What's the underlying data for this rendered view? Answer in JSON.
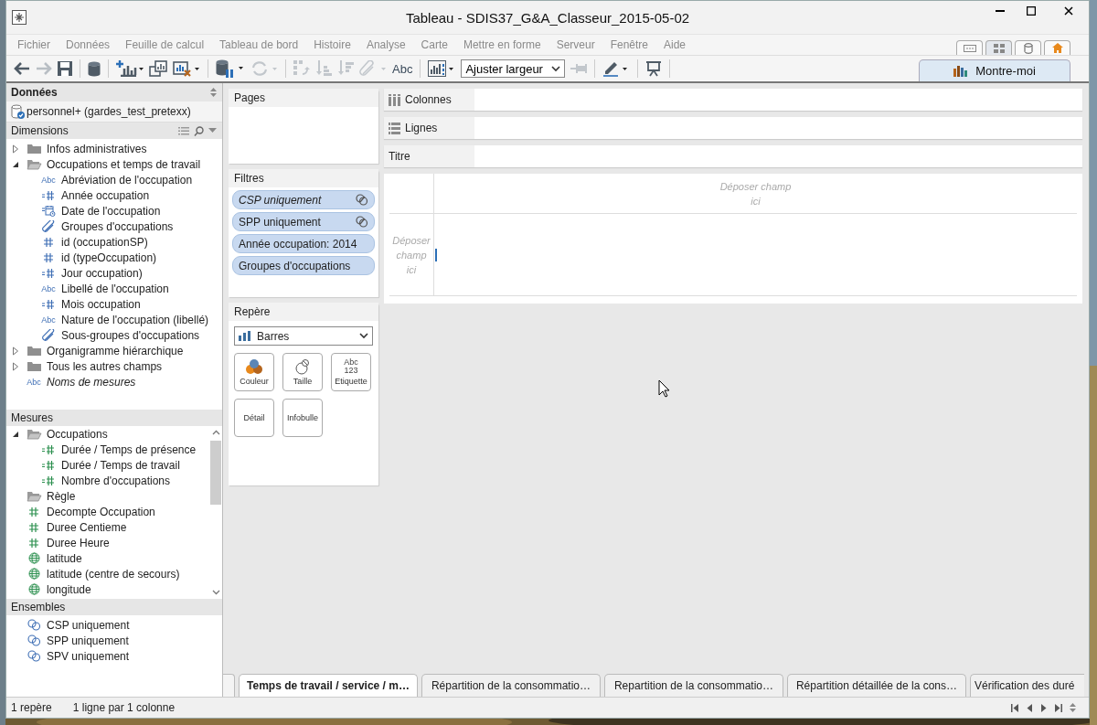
{
  "window": {
    "title": "Tableau - SDIS37_G&A_Classeur_2015-05-02"
  },
  "menu": [
    "Fichier",
    "Données",
    "Feuille de calcul",
    "Tableau de bord",
    "Histoire",
    "Analyse",
    "Carte",
    "Mettre en forme",
    "Serveur",
    "Fenêtre",
    "Aide"
  ],
  "toolbar": {
    "label_button": "Abc",
    "fit": "Ajuster largeur",
    "show_me": "Montre-moi"
  },
  "data_pane": {
    "title": "Données",
    "source": "personnel+ (gardes_test_pretexx)",
    "dimensions": {
      "title": "Dimensions",
      "items": [
        {
          "label": "Infos administratives",
          "kind": "folder",
          "expanded": false
        },
        {
          "label": "Occupations et temps de travail",
          "kind": "folder",
          "expanded": true,
          "children": [
            {
              "label": "Abréviation de l'occupation",
              "kind": "abc",
              "type_label": "Abc"
            },
            {
              "label": "Année occupation",
              "kind": "discrete-number"
            },
            {
              "label": "Date de l'occupation",
              "kind": "date"
            },
            {
              "label": "Groupes d'occupations",
              "kind": "group"
            },
            {
              "label": "id (occupationSP)",
              "kind": "number"
            },
            {
              "label": "id (typeOccupation)",
              "kind": "number"
            },
            {
              "label": "Jour occupation)",
              "kind": "discrete-number"
            },
            {
              "label": "Libellé de l'occupation",
              "kind": "abc",
              "type_label": "Abc"
            },
            {
              "label": "Mois occupation",
              "kind": "discrete-number"
            },
            {
              "label": "Nature de l'occupation (libellé)",
              "kind": "abc",
              "type_label": "Abc"
            },
            {
              "label": "Sous-groupes d'occupations",
              "kind": "group"
            }
          ]
        },
        {
          "label": "Organigramme hiérarchique",
          "kind": "folder",
          "expanded": false
        },
        {
          "label": "Tous les autres champs",
          "kind": "folder",
          "expanded": false
        },
        {
          "label": "Noms de mesures",
          "kind": "measure-names",
          "type_label": "Abc"
        }
      ]
    },
    "measures": {
      "title": "Mesures",
      "items": [
        {
          "label": "Occupations",
          "kind": "folder",
          "expanded": true,
          "children": [
            {
              "label": "Durée / Temps de présence",
              "kind": "discrete-number"
            },
            {
              "label": "Durée / Temps de travail",
              "kind": "discrete-number"
            },
            {
              "label": "Nombre d'occupations",
              "kind": "discrete-number"
            }
          ]
        },
        {
          "label": "Règle",
          "kind": "folder",
          "expanded": true
        },
        {
          "label": "Decompte Occupation",
          "kind": "number"
        },
        {
          "label": "Duree Centieme",
          "kind": "number"
        },
        {
          "label": "Duree Heure",
          "kind": "number"
        },
        {
          "label": "latitude",
          "kind": "globe"
        },
        {
          "label": "latitude (centre de secours)",
          "kind": "globe"
        },
        {
          "label": "longitude",
          "kind": "globe"
        }
      ]
    },
    "sets": {
      "title": "Ensembles",
      "items": [
        {
          "label": "CSP uniquement",
          "kind": "set"
        },
        {
          "label": "SPP uniquement",
          "kind": "set"
        },
        {
          "label": "SPV uniquement",
          "kind": "set"
        }
      ]
    }
  },
  "pages": {
    "title": "Pages"
  },
  "filters": {
    "title": "Filtres",
    "pills": [
      {
        "label": "CSP uniquement",
        "kind": "set",
        "italic": true
      },
      {
        "label": "SPP uniquement",
        "kind": "set",
        "italic": false
      },
      {
        "label": "Année occupation: 2014",
        "kind": "field",
        "italic": false
      },
      {
        "label": "Groupes d'occupations",
        "kind": "field",
        "italic": false
      }
    ]
  },
  "marks": {
    "title": "Repère",
    "mark_type": "Barres",
    "cards": [
      {
        "kind": "color",
        "label": "Couleur"
      },
      {
        "kind": "size",
        "label": "Taille"
      },
      {
        "kind": "text",
        "label": "Etiquette",
        "icon_lines": [
          "Abc",
          "123"
        ]
      },
      {
        "kind": "detail",
        "label": "Détail"
      },
      {
        "kind": "tooltip",
        "label": "Infobulle"
      }
    ]
  },
  "shelves": [
    {
      "kind": "columns",
      "label": "Colonnes"
    },
    {
      "kind": "rows",
      "label": "Lignes"
    },
    {
      "kind": "title",
      "label": "Titre"
    }
  ],
  "canvas": {
    "column_drop": "Déposer champ ici",
    "row_drop": "Déposer champ ici"
  },
  "sheet_tabs": [
    {
      "label": "Temps de travail / service / m…",
      "selected": true
    },
    {
      "label": "Répartition de la consommatio…",
      "selected": false
    },
    {
      "label": "Repartition de la consommatio…",
      "selected": false
    },
    {
      "label": "Répartition détaillée de la cons…",
      "selected": false
    },
    {
      "label": "Vérification des duré",
      "selected": false
    }
  ],
  "status_bar": [
    "1 repère",
    "1 ligne par 1 colonne"
  ]
}
